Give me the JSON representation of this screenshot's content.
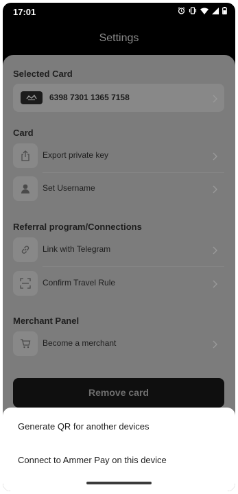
{
  "status_bar": {
    "time": "17:01",
    "icons": [
      "alarm-icon",
      "vibrate-icon",
      "wifi-icon",
      "signal-icon",
      "battery-icon"
    ]
  },
  "header": {
    "title": "Settings"
  },
  "selected_card": {
    "section_title": "Selected Card",
    "card_number": "6398 7301 1365 7158"
  },
  "card_section": {
    "section_title": "Card",
    "items": [
      {
        "label": "Export private key",
        "icon": "share-icon"
      },
      {
        "label": "Set Username",
        "icon": "user-icon"
      }
    ]
  },
  "referral_section": {
    "section_title": "Referral program/Connections",
    "items": [
      {
        "label": "Link with Telegram",
        "icon": "link-icon"
      },
      {
        "label": "Confirm Travel Rule",
        "icon": "scan-icon"
      }
    ]
  },
  "merchant_section": {
    "section_title": "Merchant Panel",
    "items": [
      {
        "label": "Become a merchant",
        "icon": "cart-icon"
      }
    ]
  },
  "remove_button": {
    "label": "Remove card"
  },
  "bottom_sheet": {
    "options": [
      {
        "label": "Generate QR for another devices"
      },
      {
        "label": "Connect to Ammer Pay on this device"
      }
    ]
  },
  "colors": {
    "overlay_background": "#7c7c7c",
    "row_background": "#888888",
    "sheet_background": "#ffffff",
    "button_background": "#0f0f0f"
  }
}
